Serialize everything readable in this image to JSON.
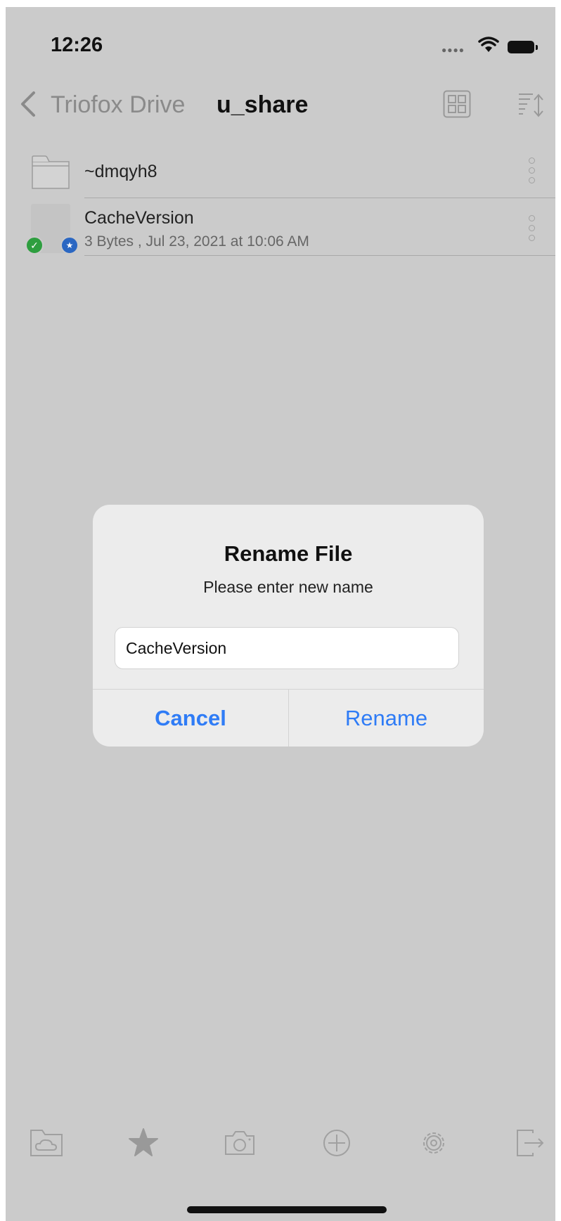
{
  "status_bar": {
    "time": "12:26"
  },
  "nav": {
    "back_label": "Triofox Drive",
    "title": "u_share"
  },
  "files": [
    {
      "name": "~dmqyh8",
      "type": "folder"
    },
    {
      "name": "CacheVersion",
      "type": "file",
      "meta": "3 Bytes , Jul 23, 2021 at 10:06 AM"
    }
  ],
  "dialog": {
    "title": "Rename File",
    "message": "Please enter new name",
    "input_value": "CacheVersion",
    "cancel_label": "Cancel",
    "rename_label": "Rename"
  },
  "tab_bar": {
    "icons": [
      "folder-cloud-icon",
      "star-icon",
      "camera-icon",
      "add-circle-icon",
      "gear-icon",
      "logout-icon"
    ]
  },
  "colors": {
    "background_dim": "#cbcbcb",
    "accent": "#2f7cf6",
    "sync_ok": "#2e9e3f",
    "favorite_badge": "#2b67c2"
  }
}
